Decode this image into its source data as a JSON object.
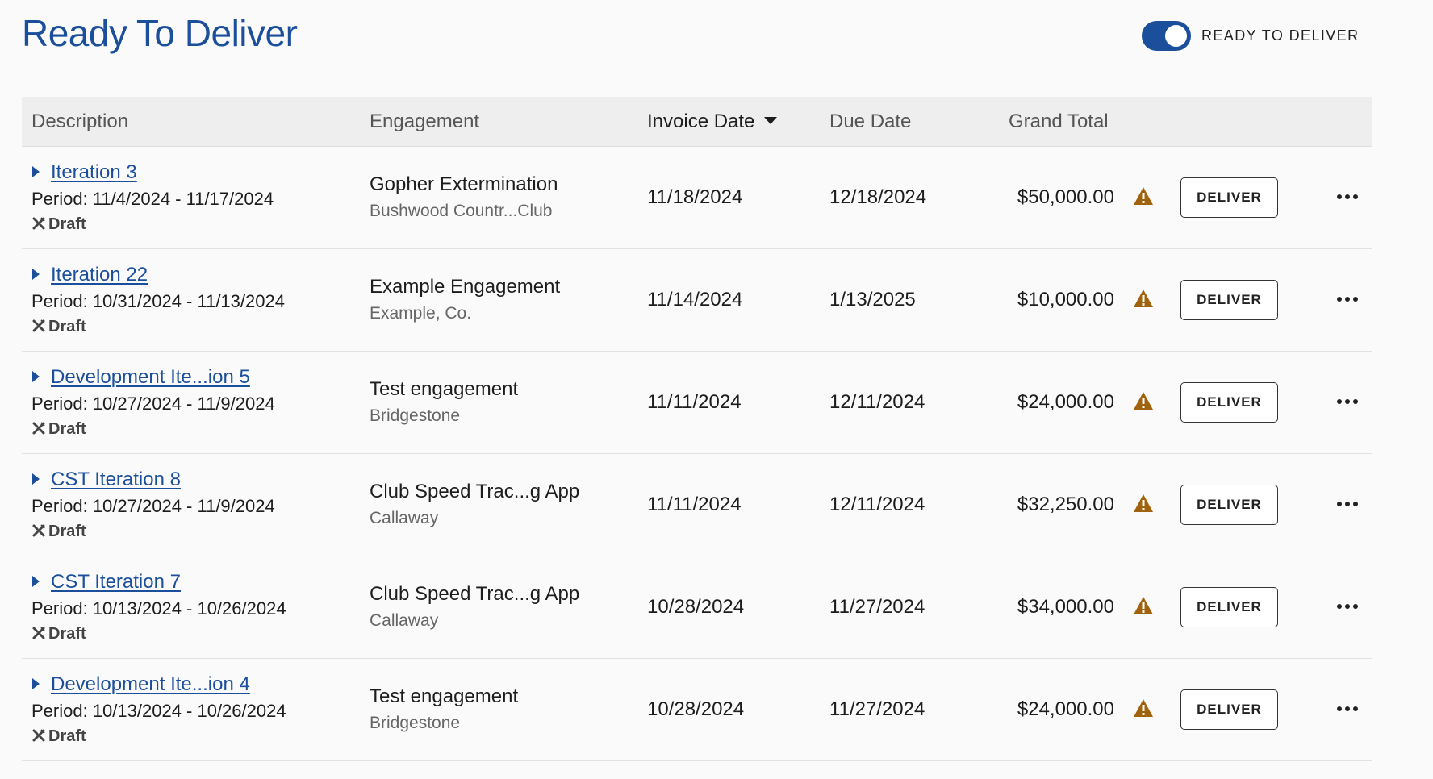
{
  "page": {
    "title": "Ready To Deliver",
    "toggle": {
      "label": "READY TO DELIVER",
      "on": true
    }
  },
  "colors": {
    "accent": "#1b4f9c",
    "warning": "#a0620c"
  },
  "table": {
    "columns": {
      "description": "Description",
      "engagement": "Engagement",
      "invoice_date": "Invoice Date",
      "due_date": "Due Date",
      "grand_total": "Grand Total"
    },
    "sorted_by": "invoice_date",
    "sort_direction": "descending",
    "row_icons": [
      "caret-right-icon",
      "draft-icon",
      "warning-icon",
      "more-icon"
    ],
    "rows": [
      {
        "title": "Iteration 3",
        "period": "Period: 11/4/2024 - 11/17/2024",
        "status": "Draft",
        "engagement": "Gopher Extermination",
        "client": "Bushwood Countr...Club",
        "invoice_date": "11/18/2024",
        "due_date": "12/18/2024",
        "total": "$50,000.00",
        "action": "DELIVER"
      },
      {
        "title": "Iteration 22",
        "period": "Period: 10/31/2024 - 11/13/2024",
        "status": "Draft",
        "engagement": "Example Engagement",
        "client": "Example, Co.",
        "invoice_date": "11/14/2024",
        "due_date": "1/13/2025",
        "total": "$10,000.00",
        "action": "DELIVER"
      },
      {
        "title": "Development Ite...ion 5",
        "period": "Period: 10/27/2024 - 11/9/2024",
        "status": "Draft",
        "engagement": "Test engagement",
        "client": "Bridgestone",
        "invoice_date": "11/11/2024",
        "due_date": "12/11/2024",
        "total": "$24,000.00",
        "action": "DELIVER"
      },
      {
        "title": "CST Iteration 8",
        "period": "Period: 10/27/2024 - 11/9/2024",
        "status": "Draft",
        "engagement": "Club Speed Trac...g App",
        "client": "Callaway",
        "invoice_date": "11/11/2024",
        "due_date": "12/11/2024",
        "total": "$32,250.00",
        "action": "DELIVER"
      },
      {
        "title": "CST Iteration 7",
        "period": "Period: 10/13/2024 - 10/26/2024",
        "status": "Draft",
        "engagement": "Club Speed Trac...g App",
        "client": "Callaway",
        "invoice_date": "10/28/2024",
        "due_date": "11/27/2024",
        "total": "$34,000.00",
        "action": "DELIVER"
      },
      {
        "title": "Development Ite...ion 4",
        "period": "Period: 10/13/2024 - 10/26/2024",
        "status": "Draft",
        "engagement": "Test engagement",
        "client": "Bridgestone",
        "invoice_date": "10/28/2024",
        "due_date": "11/27/2024",
        "total": "$24,000.00",
        "action": "DELIVER"
      }
    ]
  }
}
